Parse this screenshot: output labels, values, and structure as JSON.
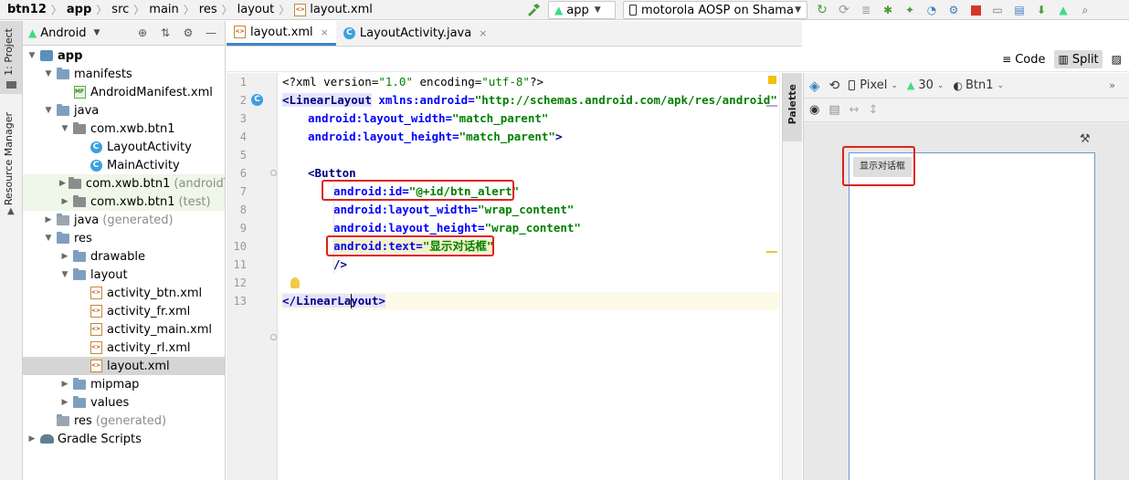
{
  "breadcrumbs": {
    "items": [
      "btn12",
      "app",
      "src",
      "main",
      "res",
      "layout",
      "layout.xml"
    ]
  },
  "toolbar": {
    "module_combo": "app",
    "device_combo": "motorola AOSP on Shama"
  },
  "left_strip": {
    "project_tab": "1: Project",
    "resource_manager_tab": "Resource Manager"
  },
  "project_panel": {
    "view_mode": "Android",
    "tree": [
      {
        "label": "app",
        "dim": "",
        "level": 0,
        "icon": "app-module-icon",
        "expanded": true,
        "bold": true
      },
      {
        "label": "manifests",
        "dim": "",
        "level": 1,
        "icon": "folder-icon",
        "expanded": true
      },
      {
        "label": "AndroidManifest.xml",
        "dim": "",
        "level": 2,
        "icon": "manifest-file-icon",
        "leaf": true
      },
      {
        "label": "java",
        "dim": "",
        "level": 1,
        "icon": "folder-icon",
        "expanded": true
      },
      {
        "label": "com.xwb.btn1",
        "dim": "",
        "level": 2,
        "icon": "package-icon",
        "expanded": true
      },
      {
        "label": "LayoutActivity",
        "dim": "",
        "level": 3,
        "icon": "class-icon",
        "leaf": true
      },
      {
        "label": "MainActivity",
        "dim": "",
        "level": 3,
        "icon": "class-icon",
        "leaf": true
      },
      {
        "label": "com.xwb.btn1",
        "dim": "(androidTe",
        "level": 2,
        "icon": "package-icon",
        "collapsed": true,
        "green": true
      },
      {
        "label": "com.xwb.btn1",
        "dim": "(test)",
        "level": 2,
        "icon": "package-icon",
        "collapsed": true,
        "green": true
      },
      {
        "label": "java",
        "dim": "(generated)",
        "level": 1,
        "icon": "generated-folder-icon",
        "collapsed": true
      },
      {
        "label": "res",
        "dim": "",
        "level": 1,
        "icon": "res-folder-icon",
        "expanded": true
      },
      {
        "label": "drawable",
        "dim": "",
        "level": 2,
        "icon": "folder-icon",
        "collapsed": true
      },
      {
        "label": "layout",
        "dim": "",
        "level": 2,
        "icon": "folder-icon",
        "expanded": true
      },
      {
        "label": "activity_btn.xml",
        "dim": "",
        "level": 3,
        "icon": "xml-file-icon",
        "leaf": true
      },
      {
        "label": "activity_fr.xml",
        "dim": "",
        "level": 3,
        "icon": "xml-file-icon",
        "leaf": true
      },
      {
        "label": "activity_main.xml",
        "dim": "",
        "level": 3,
        "icon": "xml-file-icon",
        "leaf": true
      },
      {
        "label": "activity_rl.xml",
        "dim": "",
        "level": 3,
        "icon": "xml-file-icon",
        "leaf": true
      },
      {
        "label": "layout.xml",
        "dim": "",
        "level": 3,
        "icon": "xml-file-icon",
        "leaf": true,
        "selected": true
      },
      {
        "label": "mipmap",
        "dim": "",
        "level": 2,
        "icon": "folder-icon",
        "collapsed": true
      },
      {
        "label": "values",
        "dim": "",
        "level": 2,
        "icon": "folder-icon",
        "collapsed": true
      },
      {
        "label": "res",
        "dim": "(generated)",
        "level": 1,
        "icon": "generated-folder-icon",
        "leaf": true
      },
      {
        "label": "Gradle Scripts",
        "dim": "",
        "level": 0,
        "icon": "gradle-icon",
        "collapsed": true
      }
    ]
  },
  "editor": {
    "tabs": [
      {
        "label": "layout.xml",
        "active": true
      },
      {
        "label": "LayoutActivity.java",
        "active": false
      }
    ],
    "view_modes": {
      "code": "Code",
      "split": "Split"
    },
    "line_numbers": [
      "1",
      "2",
      "3",
      "4",
      "5",
      "6",
      "7",
      "8",
      "9",
      "10",
      "11",
      "12",
      "13"
    ],
    "code": {
      "l1_open": "<?xml version=",
      "l1_ver": "\"1.0\"",
      "l1_enc_attr": " encoding=",
      "l1_enc": "\"utf-8\"",
      "l1_close": "?>",
      "l2_lt": "<",
      "l2_tag": "LinearLayout",
      "l2_attr": " xmlns:android=",
      "l2_val": "\"http://schemas.android.com/apk/res/android\"",
      "l3_attr": "android:layout_width=",
      "l3_val": "\"match_parent\"",
      "l4_attr": "android:layout_height=",
      "l4_val": "\"match_parent\"",
      "l4_close": ">",
      "l6_tag": "<Button",
      "l7_attr": "android:id=",
      "l7_val": "\"@+id/btn_alert\"",
      "l8_attr": "android:layout_width=",
      "l8_val": "\"wrap_content\"",
      "l9_attr": "android:layout_height=",
      "l9_val": "\"wrap_content\"",
      "l10_attr": "android:text=",
      "l10_val": "\"显示对话框\"",
      "l11_close": "/>",
      "l13_tag": "</LinearLayout>"
    }
  },
  "palette": {
    "label": "Palette"
  },
  "design": {
    "device": "Pixel",
    "api_level": "30",
    "theme": "Btn1",
    "preview_button_text": "显示对话框"
  },
  "colors": {
    "highlight_red": "#e0201b",
    "tab_accent": "#4083c9",
    "xml_tag": "#000080",
    "xml_attr": "#0000ff",
    "xml_string": "#008000"
  }
}
